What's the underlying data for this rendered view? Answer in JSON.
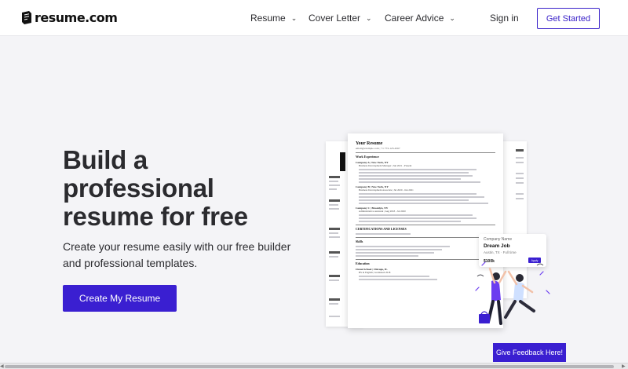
{
  "header": {
    "logo_text": "resume.com",
    "nav": [
      {
        "label": "Resume"
      },
      {
        "label": "Cover Letter"
      },
      {
        "label": "Career Advice"
      }
    ],
    "signin_label": "Sign in",
    "get_started_label": "Get Started"
  },
  "hero": {
    "title": "Build a professional resume for free",
    "subtitle": "Create your resume easily with our free builder and professional templates.",
    "cta_label": "Create My Resume"
  },
  "illustration": {
    "resume": {
      "name": "Your Resume",
      "contact": "email@example.com | +1 773-123-4567",
      "section_work": "Work Experience",
      "job1": "Company A | New York, NY",
      "job1_role": "Business Development Manager | Jun 2021 - Present",
      "job2": "Company B | New York, NY",
      "job2_role": "Business Development Associate | Jul 2020 - Jun 2021",
      "job3": "Company C | Brooklyn, NY",
      "job3_role": "Administrative Assistant | Aug 2018 - Jul 2020",
      "section_certs": "CERTIFICATIONS AND LICENSES",
      "section_skills": "Skills",
      "section_edu": "Education",
      "edu1": "Ocean School | Chicago, IL",
      "edu2": "BS in English | Graduated 2018"
    },
    "job_card": {
      "company": "Company Name",
      "title": "Dream Job",
      "location": "Austin, TX · Full time",
      "pay": "$100k",
      "apply": "Apply"
    }
  },
  "feedback_label": "Give Feedback Here!",
  "colors": {
    "brand": "#3a1fd1",
    "background": "#f4f4f7"
  },
  "icons": {
    "nav_dropdown": "chevron-down-icon",
    "logo": "resume-logo-icon"
  }
}
